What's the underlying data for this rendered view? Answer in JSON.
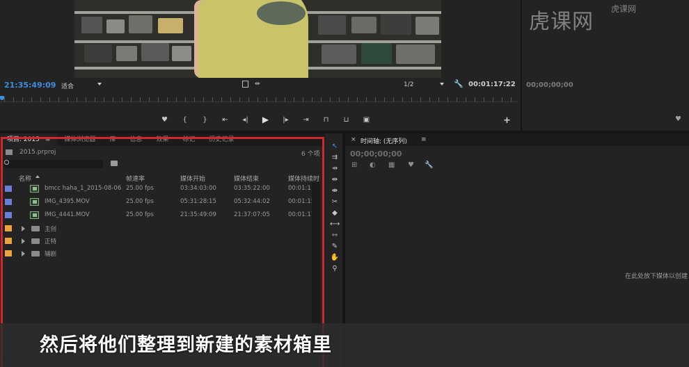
{
  "program_monitor": {
    "timecode_current": "21:35:49:09",
    "zoom_fit": "适合",
    "resolution": "1/2",
    "timecode_duration": "00:01:17:22"
  },
  "source_monitor": {
    "timecode": "00;00;00;00"
  },
  "watermark": {
    "text": "虎课网",
    "sub": "虎课网"
  },
  "project_panel": {
    "tabs": [
      {
        "label": "项目: 2015",
        "active": true
      },
      {
        "label": "媒体浏览器"
      },
      {
        "label": "库"
      },
      {
        "label": "信息"
      },
      {
        "label": "效果"
      },
      {
        "label": "标记"
      },
      {
        "label": "历史记录"
      }
    ],
    "menu_glyph": "≡",
    "project_file": "2015.prproj",
    "item_count": "6 个项",
    "columns": {
      "name": "名称",
      "fps": "帧速率",
      "media_start": "媒体开始",
      "media_end": "媒体结束",
      "media_duration": "媒体持续时"
    },
    "clips": [
      {
        "name": "bmcc haha_1_2015-08-06_0",
        "fps": "25.00 fps",
        "start": "03:34:03:00",
        "end": "03:35:22:00",
        "duration": "00:01:1!",
        "color": "#6a7fd6"
      },
      {
        "name": "IMG_4395.MOV",
        "fps": "25.00 fps",
        "start": "05:31:28:15",
        "end": "05:32:44:02",
        "duration": "00:01:15",
        "color": "#6a7fd6"
      },
      {
        "name": "IMG_4441.MOV",
        "fps": "25.00 fps",
        "start": "21:35:49:09",
        "end": "21:37:07:05",
        "duration": "00:01:17",
        "color": "#6a7fd6"
      }
    ],
    "bins": [
      {
        "name": "主创",
        "color": "#f0a23a"
      },
      {
        "name": "正特",
        "color": "#f0a23a"
      },
      {
        "name": "辅剧",
        "color": "#f0a23a"
      }
    ]
  },
  "timeline": {
    "close_glyph": "×",
    "title": "时间轴: (无序列)",
    "menu_glyph": "≡",
    "timecode": "00;00;00;00",
    "drop_hint": "在此处放下媒体以创建"
  },
  "subtitle": "然后将他们整理到新建的素材箱里",
  "icons": {
    "transport": [
      "marker-icon",
      "mark-in-icon",
      "mark-out-icon",
      "go-to-in-icon",
      "step-back-icon",
      "play-icon",
      "step-forward-icon",
      "go-to-out-icon",
      "lift-icon",
      "extract-icon",
      "export-frame-icon"
    ],
    "tools": [
      "selection-tool-icon",
      "track-select-tool-icon",
      "ripple-edit-tool-icon",
      "rolling-edit-tool-icon",
      "rate-stretch-tool-icon",
      "razor-tool-icon",
      "slip-tool-icon",
      "slide-tool-icon",
      "pen-tool-icon",
      "hand-tool-icon",
      "zoom-tool-icon"
    ]
  }
}
